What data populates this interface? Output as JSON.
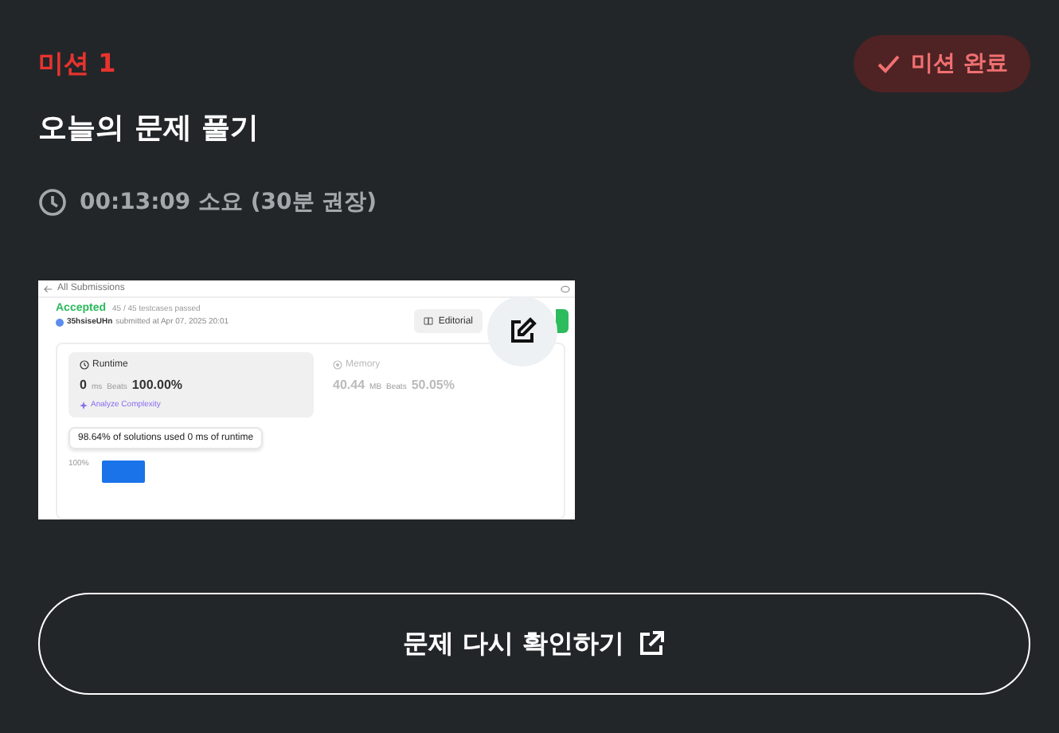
{
  "mission": {
    "label": "미션 1",
    "status_badge": "미션 완료"
  },
  "title": "오늘의 문제 풀기",
  "duration": "00:13:09 소요 (30분 권장)",
  "screenshot": {
    "back_link": "All Submissions",
    "status": "Accepted",
    "testcases": "45 / 45 testcases passed",
    "user": "35hsiseUHn",
    "submitted": "submitted at Apr 07, 2025 20:01",
    "editorial_button": "Editorial",
    "runtime": {
      "label": "Runtime",
      "value": "0",
      "unit": "ms",
      "beats_label": "Beats",
      "beats": "100.00%",
      "link": "Analyze Complexity"
    },
    "memory": {
      "label": "Memory",
      "value": "40.44",
      "unit": "MB",
      "beats_label": "Beats",
      "beats": "50.05%"
    },
    "tooltip": "98.64% of solutions used 0 ms of runtime",
    "axis_label": "100%"
  },
  "action_button": "문제 다시 확인하기"
}
